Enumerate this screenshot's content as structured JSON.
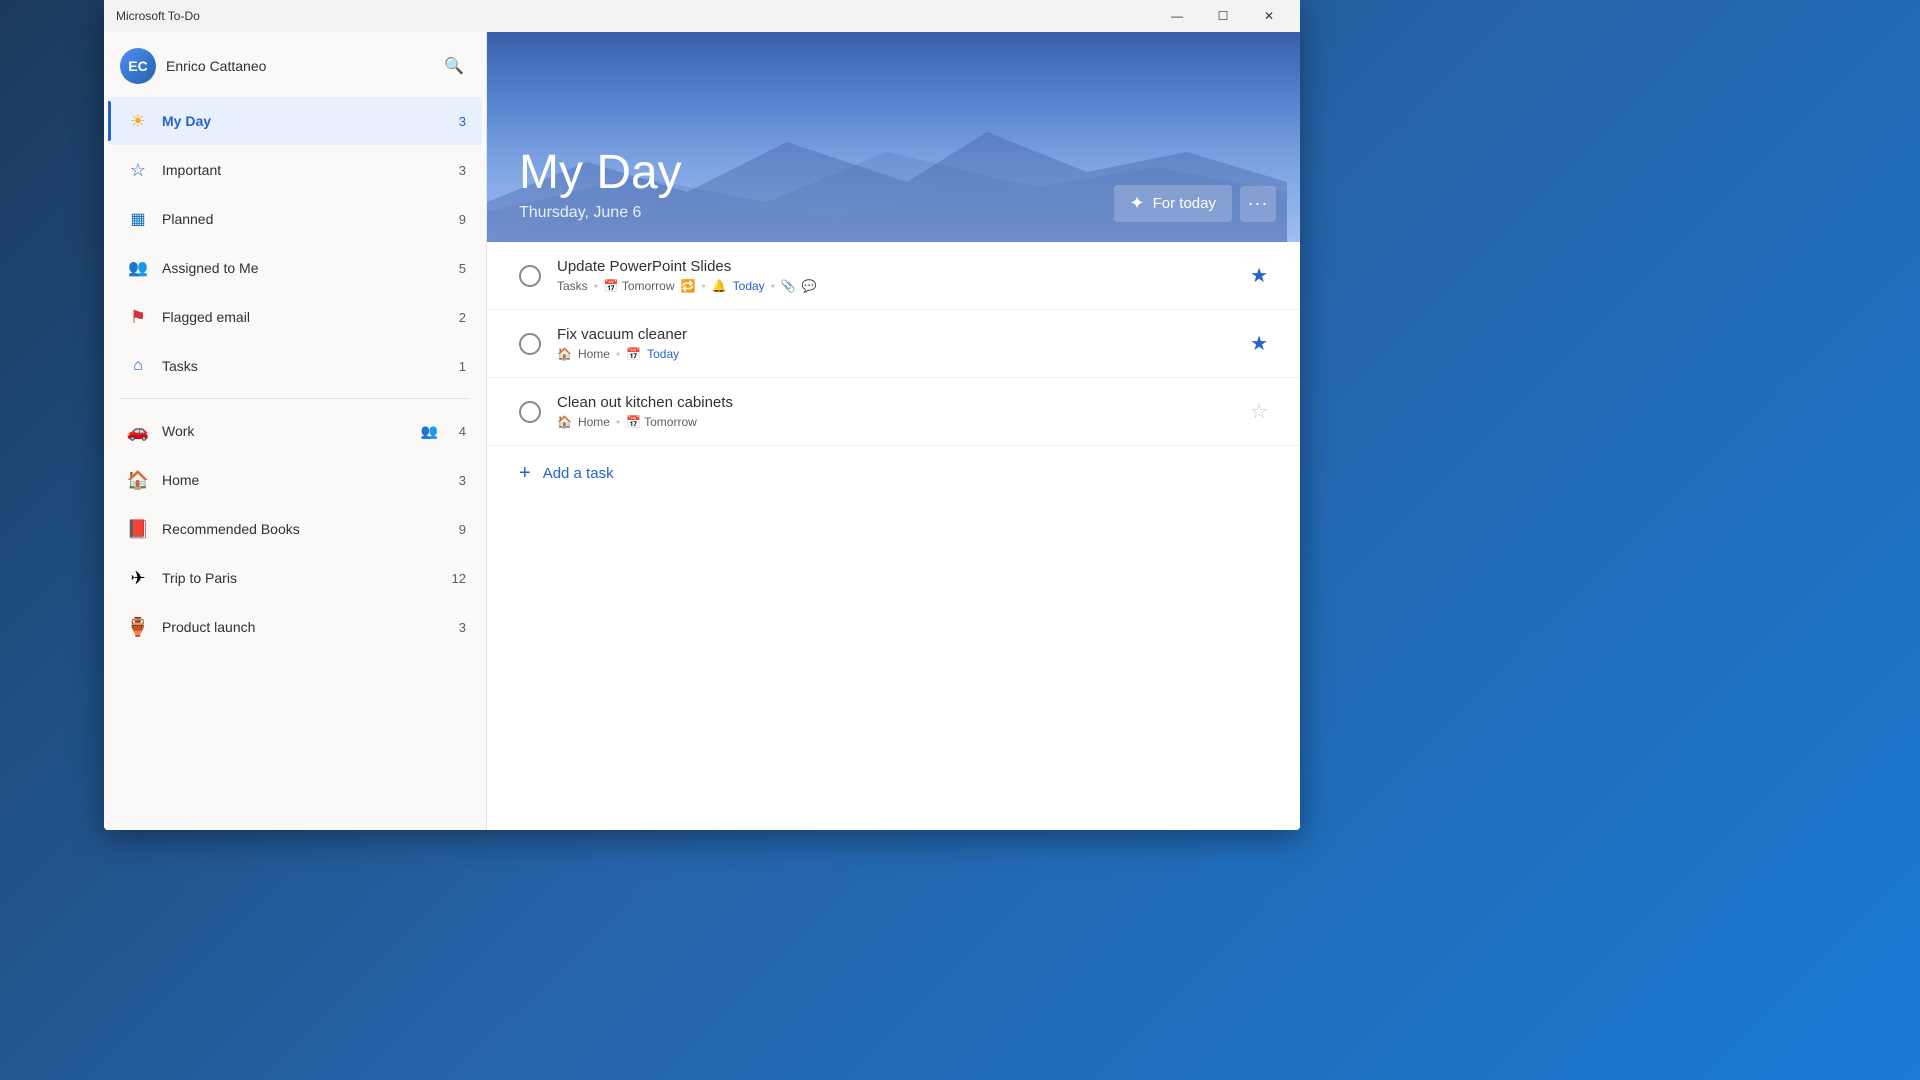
{
  "app": {
    "title": "Microsoft To-Do",
    "window_title": "Microsoft To-Do"
  },
  "titlebar": {
    "minimize_label": "—",
    "maximize_label": "☐",
    "close_label": "✕"
  },
  "sidebar": {
    "user": {
      "name": "Enrico Cattaneo",
      "initials": "EC"
    },
    "search_tooltip": "Search",
    "nav_items": [
      {
        "id": "my-day",
        "label": "My Day",
        "count": "3",
        "icon": "☀",
        "active": true,
        "icon_color": "#f5a623"
      },
      {
        "id": "important",
        "label": "Important",
        "count": "3",
        "icon": "★",
        "icon_color": "#2564cf"
      },
      {
        "id": "planned",
        "label": "Planned",
        "count": "9",
        "icon": "▦",
        "icon_color": "#106ebe"
      },
      {
        "id": "assigned-to-me",
        "label": "Assigned to Me",
        "count": "5",
        "icon": "👥",
        "icon_color": "#3a7bd5"
      },
      {
        "id": "flagged-email",
        "label": "Flagged email",
        "count": "2",
        "icon": "⚑",
        "icon_color": "#d13438"
      },
      {
        "id": "tasks",
        "label": "Tasks",
        "count": "1",
        "icon": "⌂",
        "icon_color": "#2564cf"
      }
    ],
    "lists": [
      {
        "id": "work",
        "label": "Work",
        "count": "4",
        "icon": "🚗",
        "shared": true
      },
      {
        "id": "home",
        "label": "Home",
        "count": "3",
        "icon": "🏠"
      },
      {
        "id": "recommended-books",
        "label": "Recommended Books",
        "count": "9",
        "icon": "📕"
      },
      {
        "id": "trip-to-paris",
        "label": "Trip to Paris",
        "count": "12",
        "icon": "✈"
      },
      {
        "id": "product-launch",
        "label": "Product launch",
        "count": "3",
        "icon": "🏺"
      }
    ]
  },
  "main": {
    "title": "My Day",
    "subtitle": "Thursday, June 6",
    "for_today_label": "For today",
    "more_label": "···",
    "tasks": [
      {
        "id": "task-1",
        "title": "Update PowerPoint Slides",
        "list": "Tasks",
        "due_display": "Tomorrow",
        "has_repeat": true,
        "reminder": "Today",
        "starred": true,
        "has_note": true,
        "has_attachment": true
      },
      {
        "id": "task-2",
        "title": "Fix vacuum cleaner",
        "list": "Home",
        "due_display": "Today",
        "starred": true,
        "has_repeat": false,
        "reminder": null
      },
      {
        "id": "task-3",
        "title": "Clean out kitchen cabinets",
        "list": "Home",
        "due_display": "Tomorrow",
        "starred": false,
        "has_repeat": false,
        "reminder": null
      }
    ],
    "add_task_label": "Add a task"
  }
}
